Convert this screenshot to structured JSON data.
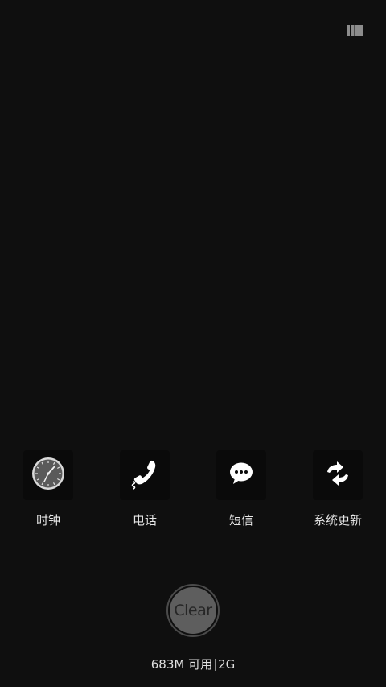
{
  "recents": {
    "view_toggle_icon": "multi-column-view-icon",
    "apps": [
      {
        "label": "时钟",
        "icon": "clock-icon"
      },
      {
        "label": "电话",
        "icon": "phone-icon"
      },
      {
        "label": "短信",
        "icon": "message-bubble-icon"
      },
      {
        "label": "系统更新",
        "icon": "system-update-icon"
      }
    ],
    "clear_label": "Clear",
    "memory": {
      "available": "683M 可用",
      "total": "2G"
    }
  },
  "colors": {
    "background": "#0f0f0f",
    "text": "#e6e6e6",
    "clear_fill": "#5e5e5e"
  }
}
